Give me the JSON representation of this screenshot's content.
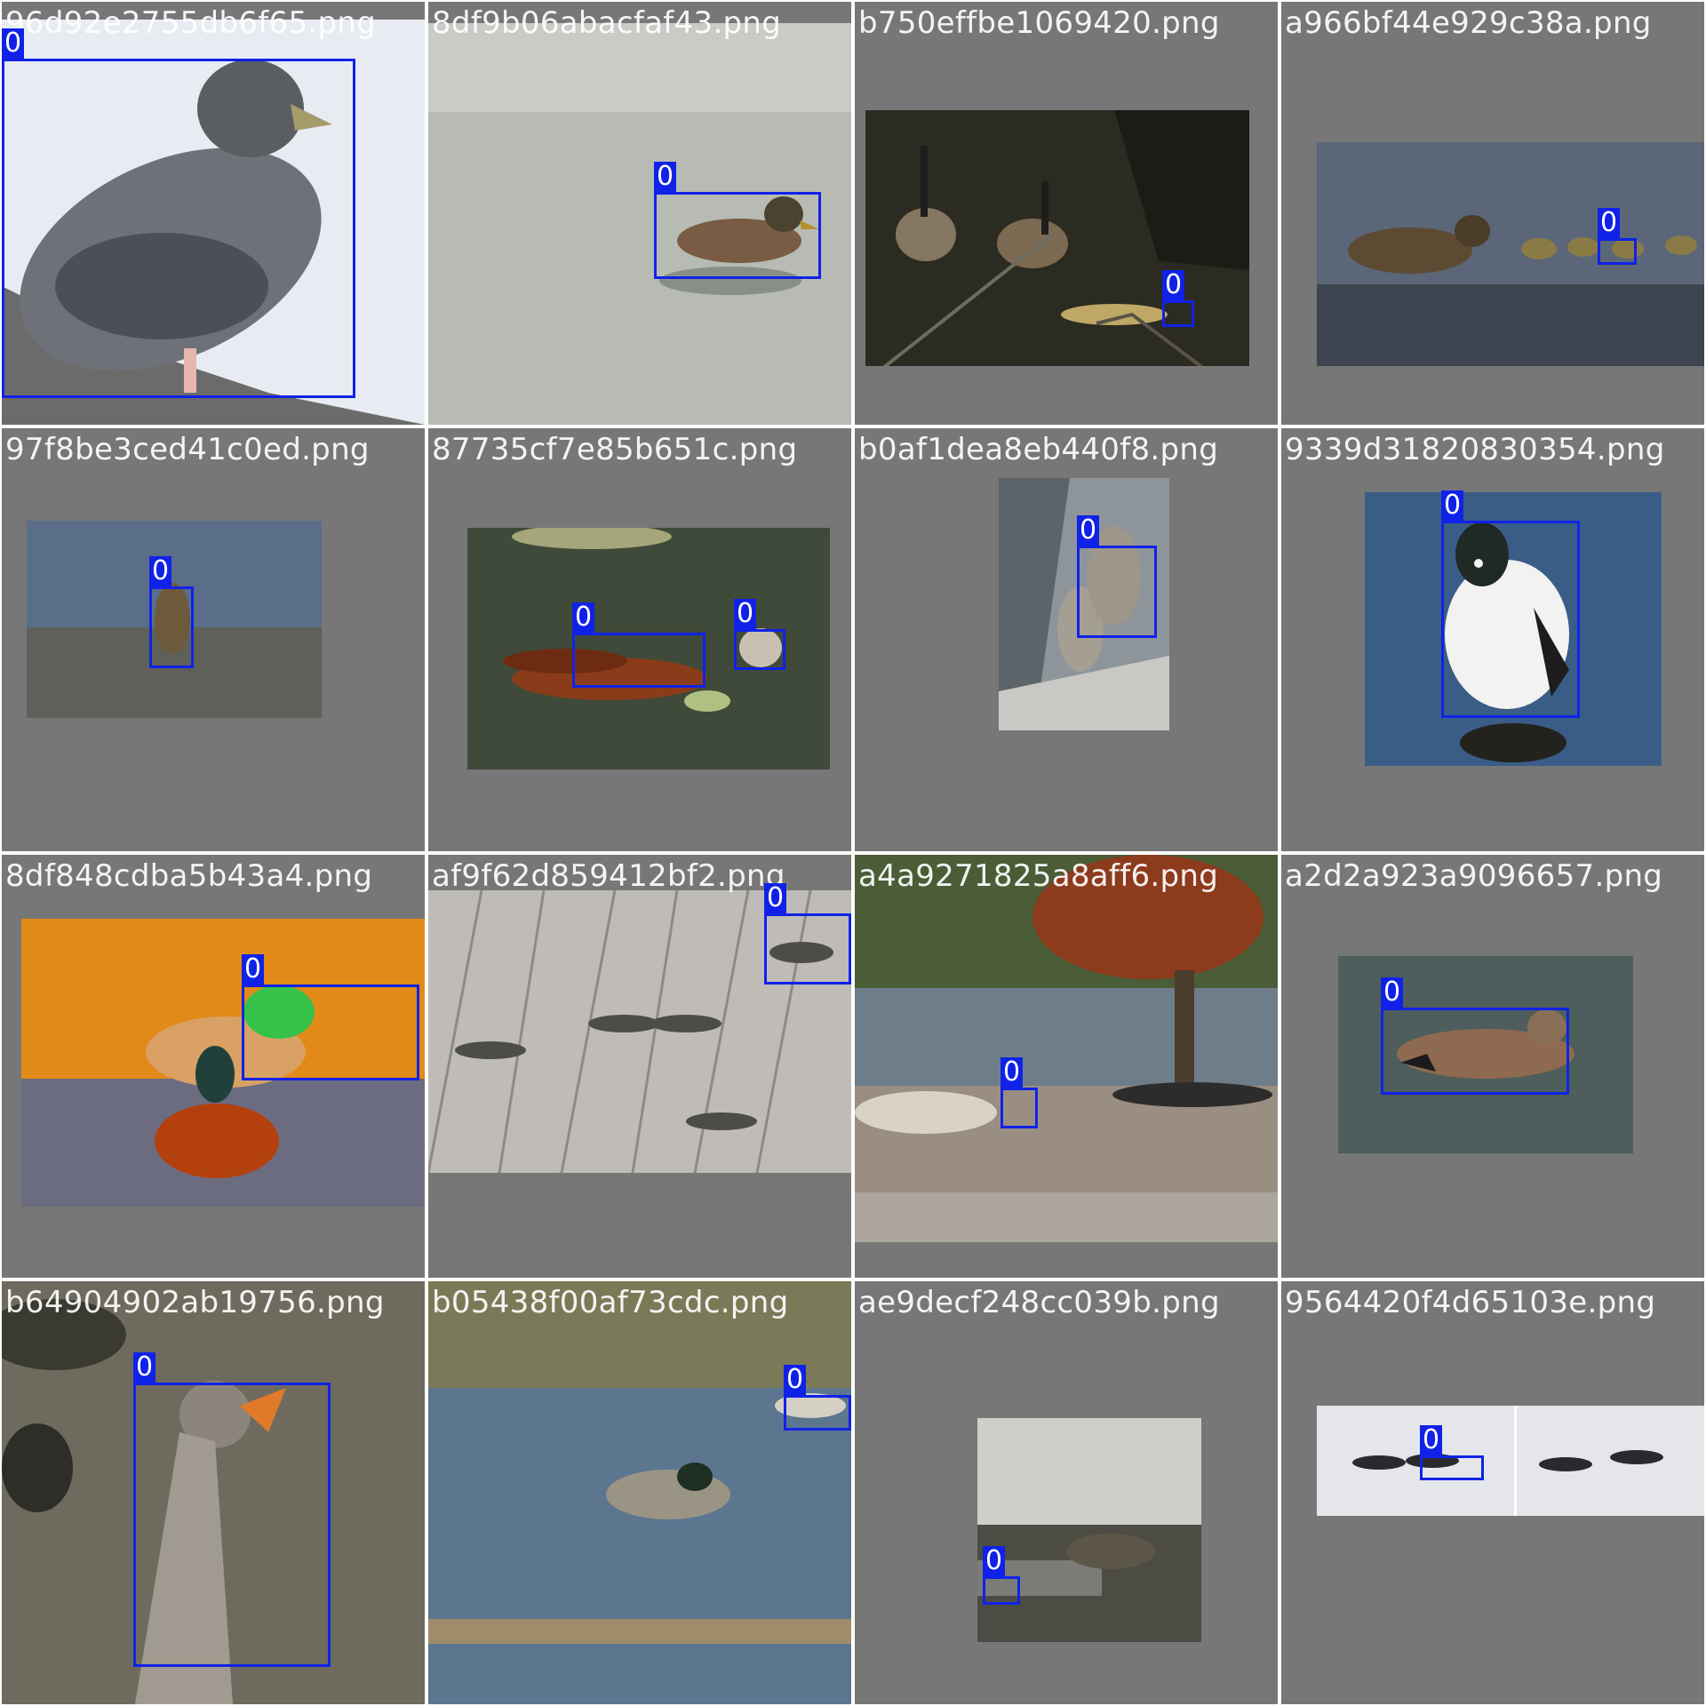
{
  "box_color": "#1022e8",
  "tile_background": "#777777",
  "tiles": [
    {
      "filename": "96d92e2755db6f65.png",
      "labels": [
        "0"
      ]
    },
    {
      "filename": "8df9b06abacfaf43.png",
      "labels": [
        "0"
      ]
    },
    {
      "filename": "b750effbe1069420.png",
      "labels": [
        "0"
      ]
    },
    {
      "filename": "a966bf44e929c38a.png",
      "labels": [
        "0"
      ]
    },
    {
      "filename": "97f8be3ced41c0ed.png",
      "labels": [
        "0"
      ]
    },
    {
      "filename": "87735cf7e85b651c.png",
      "labels": [
        "0",
        "0"
      ]
    },
    {
      "filename": "b0af1dea8eb440f8.png",
      "labels": [
        "0"
      ]
    },
    {
      "filename": "9339d31820830354.png",
      "labels": [
        "0"
      ]
    },
    {
      "filename": "8df848cdba5b43a4.png",
      "labels": [
        "0"
      ]
    },
    {
      "filename": "af9f62d859412bf2.png",
      "labels": [
        "0"
      ]
    },
    {
      "filename": "a4a9271825a8aff6.png",
      "labels": [
        "0"
      ]
    },
    {
      "filename": "a2d2a923a9096657.png",
      "labels": [
        "0"
      ]
    },
    {
      "filename": "b64904902ab19756.png",
      "labels": [
        "0"
      ]
    },
    {
      "filename": "b05438f00af73cdc.png",
      "labels": [
        "0"
      ]
    },
    {
      "filename": "ae9decf248cc039b.png",
      "labels": [
        "0"
      ]
    },
    {
      "filename": "9564420f4d65103e.png",
      "labels": [
        "0"
      ]
    }
  ]
}
